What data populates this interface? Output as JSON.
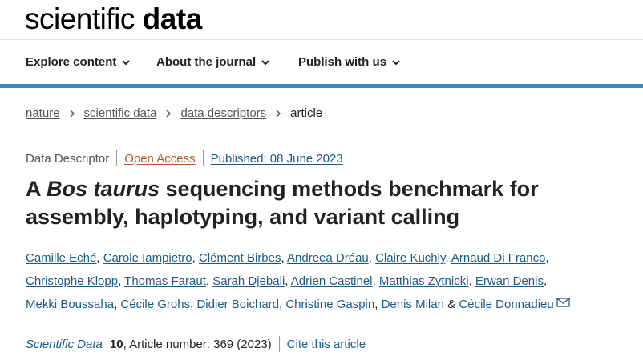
{
  "header": {
    "logo_light": "scientific",
    "logo_bold": "data"
  },
  "nav": {
    "items": [
      {
        "label": "Explore content"
      },
      {
        "label": "About the journal"
      },
      {
        "label": "Publish with us"
      }
    ]
  },
  "breadcrumb": {
    "items": [
      "nature",
      "scientific data",
      "data descriptors"
    ],
    "current": "article"
  },
  "article": {
    "type": "Data Descriptor",
    "access": "Open Access",
    "published": "Published: 08 June 2023",
    "title_prefix": "A ",
    "title_italic": "Bos taurus",
    "title_rest": " sequencing methods benchmark for assembly, haplotyping, and variant calling",
    "authors": [
      "Camille Eché",
      "Carole Iampietro",
      "Clément Birbes",
      "Andreea Dréau",
      "Claire Kuchly",
      "Arnaud Di Franco",
      "Christophe Klopp",
      "Thomas Faraut",
      "Sarah Djebali",
      "Adrien Castinel",
      "Matthias Zytnicki",
      "Erwan Denis",
      "Mekki Boussaha",
      "Cécile Grohs",
      "Didier Boichard",
      "Christine Gaspin",
      "Denis Milan"
    ],
    "author_joiner": "&",
    "last_author": "Cécile Donnadieu",
    "contact_icon": "mail-icon",
    "citation": {
      "journal": "Scientific Data",
      "volume": "10",
      "article_number": ", Article number: 369 (2023)",
      "cite_label": "Cite this article"
    }
  },
  "colors": {
    "accent_bar": "#3a87b8",
    "link": "#1a5b86",
    "open_access": "#b9562b"
  }
}
